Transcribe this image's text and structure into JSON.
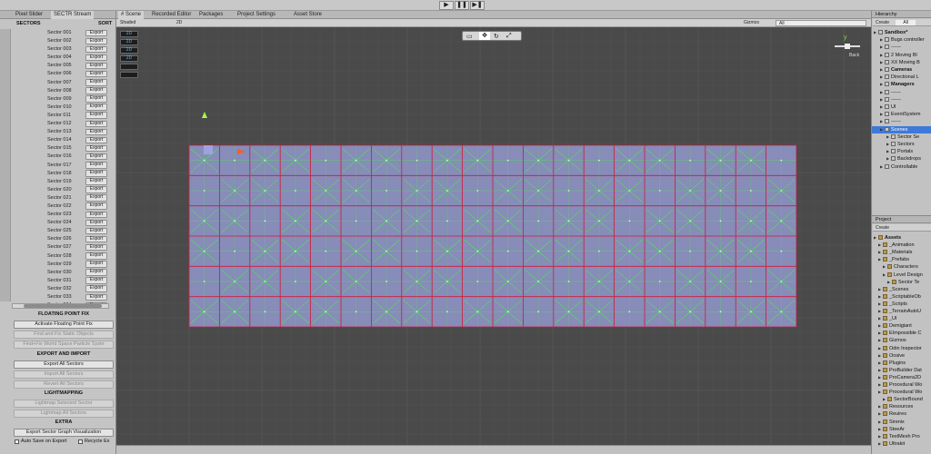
{
  "toolbar": {
    "play": "▶",
    "pause": "❚❚",
    "step": "▶❚"
  },
  "left_tabs": [
    {
      "label": "Pixel Slider"
    },
    {
      "label": "SECTR Stream"
    }
  ],
  "left_header": {
    "col1": "SECTORS",
    "col2": "SORT"
  },
  "sectors": [
    {
      "name": "Sector 001",
      "btn": "Export"
    },
    {
      "name": "Sector 002",
      "btn": "Export"
    },
    {
      "name": "Sector 003",
      "btn": "Export"
    },
    {
      "name": "Sector 004",
      "btn": "Export"
    },
    {
      "name": "Sector 005",
      "btn": "Export"
    },
    {
      "name": "Sector 006",
      "btn": "Export"
    },
    {
      "name": "Sector 007",
      "btn": "Export"
    },
    {
      "name": "Sector 008",
      "btn": "Export"
    },
    {
      "name": "Sector 009",
      "btn": "Export"
    },
    {
      "name": "Sector 010",
      "btn": "Export"
    },
    {
      "name": "Sector 011",
      "btn": "Export"
    },
    {
      "name": "Sector 012",
      "btn": "Export"
    },
    {
      "name": "Sector 013",
      "btn": "Export"
    },
    {
      "name": "Sector 014",
      "btn": "Export"
    },
    {
      "name": "Sector 015",
      "btn": "Export"
    },
    {
      "name": "Sector 016",
      "btn": "Export"
    },
    {
      "name": "Sector 017",
      "btn": "Export"
    },
    {
      "name": "Sector 018",
      "btn": "Export"
    },
    {
      "name": "Sector 019",
      "btn": "Export"
    },
    {
      "name": "Sector 020",
      "btn": "Export"
    },
    {
      "name": "Sector 021",
      "btn": "Export"
    },
    {
      "name": "Sector 022",
      "btn": "Export"
    },
    {
      "name": "Sector 023",
      "btn": "Export"
    },
    {
      "name": "Sector 024",
      "btn": "Export"
    },
    {
      "name": "Sector 025",
      "btn": "Export"
    },
    {
      "name": "Sector 026",
      "btn": "Export"
    },
    {
      "name": "Sector 027",
      "btn": "Export"
    },
    {
      "name": "Sector 028",
      "btn": "Export"
    },
    {
      "name": "Sector 029",
      "btn": "Export"
    },
    {
      "name": "Sector 030",
      "btn": "Export"
    },
    {
      "name": "Sector 031",
      "btn": "Export"
    },
    {
      "name": "Sector 032",
      "btn": "Export"
    },
    {
      "name": "Sector 033",
      "btn": "Export"
    },
    {
      "name": "Sector 034",
      "btn": "Export"
    }
  ],
  "floating": {
    "header": "FLOATING POINT FIX",
    "activate": "Activate Floating Point Fix",
    "find_fix": "Find and Fix Static Objects",
    "find_fix_ps": "Find+Fix World Space Particle Syste"
  },
  "export_import": {
    "header": "EXPORT AND IMPORT",
    "export_all": "Export All Sectors",
    "import_all": "Import All Sectors",
    "revert_all": "Revert All Sectors"
  },
  "lightmapping": {
    "header": "LIGHTMAPPING",
    "selected": "Lightmap Selected Sector",
    "all": "Lightmap All Sectors"
  },
  "extra": {
    "header": "EXTRA",
    "export_vis": "Export Sector Graph Visualization",
    "auto_save": "Auto Save on Export",
    "recycle": "Recycle Ex"
  },
  "scene_tabs": [
    {
      "label": "# Scene"
    },
    {
      "label": "Recorded Editor"
    },
    {
      "label": "Packages"
    },
    {
      "label": "Project Settings"
    },
    {
      "label": "Asset Store"
    }
  ],
  "scene_bar": {
    "shading": "Shaded",
    "mode": "2D",
    "gizmos": "Gizmos",
    "search": "All"
  },
  "hierarchy": {
    "tab": "Hierarchy",
    "create": "Create",
    "search": "All",
    "items": [
      {
        "label": "Sandbox*",
        "indent": 0,
        "sel": false,
        "bold": true
      },
      {
        "label": "Bugs controller",
        "indent": 1,
        "sel": false,
        "bold": false
      },
      {
        "label": "------",
        "indent": 1,
        "sel": false,
        "bold": false
      },
      {
        "label": "2 Moving Bl",
        "indent": 1,
        "sel": false,
        "bold": false
      },
      {
        "label": "XX Moving B",
        "indent": 1,
        "sel": false,
        "bold": false
      },
      {
        "label": "Cameras",
        "indent": 1,
        "sel": false,
        "bold": true
      },
      {
        "label": "Directional L",
        "indent": 1,
        "sel": false,
        "bold": false
      },
      {
        "label": "Managers",
        "indent": 1,
        "sel": false,
        "bold": true
      },
      {
        "label": "------",
        "indent": 1,
        "sel": false,
        "bold": false
      },
      {
        "label": "------",
        "indent": 1,
        "sel": false,
        "bold": false
      },
      {
        "label": "UI",
        "indent": 1,
        "sel": false,
        "bold": false
      },
      {
        "label": "EventSystem",
        "indent": 1,
        "sel": false,
        "bold": false
      },
      {
        "label": "------",
        "indent": 1,
        "sel": false,
        "bold": false
      },
      {
        "label": "Scenes",
        "indent": 1,
        "sel": true,
        "bold": false
      },
      {
        "label": "Sector Se",
        "indent": 2,
        "sel": false,
        "bold": false
      },
      {
        "label": "Sectors",
        "indent": 2,
        "sel": false,
        "bold": false
      },
      {
        "label": "Portals",
        "indent": 2,
        "sel": false,
        "bold": false
      },
      {
        "label": "Backdrops",
        "indent": 2,
        "sel": false,
        "bold": false
      },
      {
        "label": "Controllable",
        "indent": 1,
        "sel": false,
        "bold": false
      }
    ]
  },
  "project": {
    "tab": "Project",
    "create": "Create",
    "items": [
      {
        "label": "Assets",
        "indent": 0,
        "bold": true
      },
      {
        "label": "_Animation",
        "indent": 1,
        "bold": false
      },
      {
        "label": "_Materials",
        "indent": 1,
        "bold": false
      },
      {
        "label": "_Prefabs",
        "indent": 1,
        "bold": false
      },
      {
        "label": "Characters",
        "indent": 2,
        "bold": false
      },
      {
        "label": "Level Design",
        "indent": 2,
        "bold": false
      },
      {
        "label": "Sector Te",
        "indent": 3,
        "bold": false
      },
      {
        "label": "_Scenes",
        "indent": 1,
        "bold": false
      },
      {
        "label": "_ScriptableOb",
        "indent": 1,
        "bold": false
      },
      {
        "label": "_Scripts",
        "indent": 1,
        "bold": false
      },
      {
        "label": "_TerrainAutoU",
        "indent": 1,
        "bold": false
      },
      {
        "label": "_UI",
        "indent": 1,
        "bold": false
      },
      {
        "label": "Demigiant",
        "indent": 1,
        "bold": false
      },
      {
        "label": "EImpossible C",
        "indent": 1,
        "bold": false
      },
      {
        "label": "Gizmos",
        "indent": 1,
        "bold": false
      },
      {
        "label": "Odin Inspector",
        "indent": 1,
        "bold": false
      },
      {
        "label": "Oosive",
        "indent": 1,
        "bold": false
      },
      {
        "label": "Plugins",
        "indent": 1,
        "bold": false
      },
      {
        "label": "ProBuilder Dat",
        "indent": 1,
        "bold": false
      },
      {
        "label": "ProCamera2D",
        "indent": 1,
        "bold": false
      },
      {
        "label": "Procedural Wo",
        "indent": 1,
        "bold": false
      },
      {
        "label": "Procedural Wo",
        "indent": 1,
        "bold": false
      },
      {
        "label": "SectorBound",
        "indent": 2,
        "bold": false
      },
      {
        "label": "Resources",
        "indent": 1,
        "bold": false
      },
      {
        "label": "Reuires",
        "indent": 1,
        "bold": false
      },
      {
        "label": "Sirenix",
        "indent": 1,
        "bold": false
      },
      {
        "label": "SteeAr",
        "indent": 1,
        "bold": false
      },
      {
        "label": "TextMesh Pro",
        "indent": 1,
        "bold": false
      },
      {
        "label": "Ultrakit",
        "indent": 1,
        "bold": false
      }
    ]
  },
  "scene_overlay": {
    "toggle_values": [
      "2D",
      "2D",
      "2D",
      "2D",
      "",
      ""
    ],
    "persp": "Back"
  },
  "colors": {
    "grid_border": "#d01a3a",
    "wire": "#3cff3c",
    "cell_fill": "#8e94c4",
    "viewport_bg": "#4a4a4a",
    "selection": "#3d7ad8"
  }
}
